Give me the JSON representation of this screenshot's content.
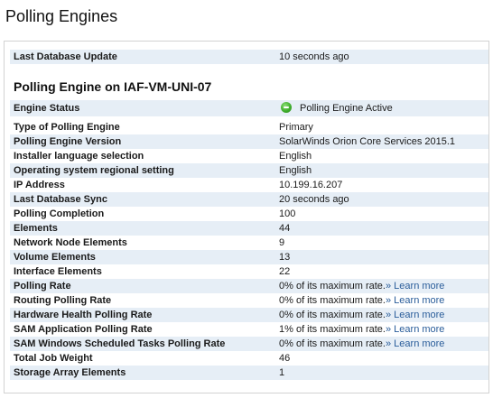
{
  "header": {
    "title": "Polling Engines"
  },
  "panel": {
    "last_update_label": "Last Database Update",
    "last_update_value": "10 seconds ago",
    "engine_title": "Polling Engine on IAF-VM-UNI-07",
    "status_label": "Engine Status",
    "status_value": "Polling Engine Active",
    "status_color": "#3fae2c",
    "learn_more": "Learn more",
    "rate_suffix": "0% of its maximum rate.",
    "rows": [
      {
        "label": "Type of Polling Engine",
        "value": "Primary"
      },
      {
        "label": "Polling Engine Version",
        "value": "SolarWinds Orion Core Services 2015.1"
      },
      {
        "label": "Installer language selection",
        "value": "English"
      },
      {
        "label": "Operating system regional setting",
        "value": "English"
      },
      {
        "label": "IP Address",
        "value": "10.199.16.207"
      },
      {
        "label": "Last Database Sync",
        "value": "20 seconds ago"
      },
      {
        "label": "Polling Completion",
        "value": "100"
      },
      {
        "label": "Elements",
        "value": "44"
      },
      {
        "label": "Network Node Elements",
        "value": "9"
      },
      {
        "label": "Volume Elements",
        "value": "13"
      },
      {
        "label": "Interface Elements",
        "value": "22"
      }
    ],
    "rate_rows": [
      {
        "label": "Polling Rate",
        "value": "0% of its maximum rate."
      },
      {
        "label": "Routing Polling Rate",
        "value": "0% of its maximum rate."
      },
      {
        "label": "Hardware Health Polling Rate",
        "value": "0% of its maximum rate."
      },
      {
        "label": "SAM Application Polling Rate",
        "value": "1% of its maximum rate."
      },
      {
        "label": "SAM Windows Scheduled Tasks Polling Rate",
        "value": "0% of its maximum rate."
      }
    ],
    "tail_rows": [
      {
        "label": "Total Job Weight",
        "value": "46"
      },
      {
        "label": "Storage Array Elements",
        "value": "1"
      }
    ],
    "link_separator": "»"
  }
}
